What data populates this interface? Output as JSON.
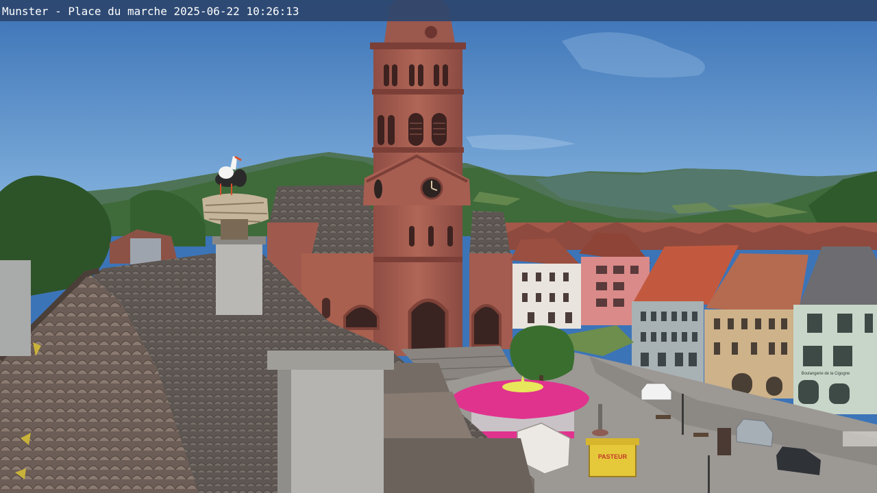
{
  "overlay": {
    "location": "Munster - Place du marche",
    "date": "2025-06-22",
    "time": "10:26:13"
  },
  "scene": {
    "description_icons": [
      "stork-nest-icon",
      "church-tower-icon",
      "clock-icon",
      "carousel-icon"
    ],
    "signage": {
      "shop_sign": "Boulangerie de la Cigogne",
      "kiosk_sign": "PASTEUR"
    }
  },
  "colors": {
    "sky_top": "#3c74b8",
    "sky_bottom": "#7fb0de",
    "sandstone": "#a35a4e",
    "roof_tiles": "#6e6660",
    "carousel_pink": "#e0338e",
    "hills": "#3f6a3a"
  }
}
